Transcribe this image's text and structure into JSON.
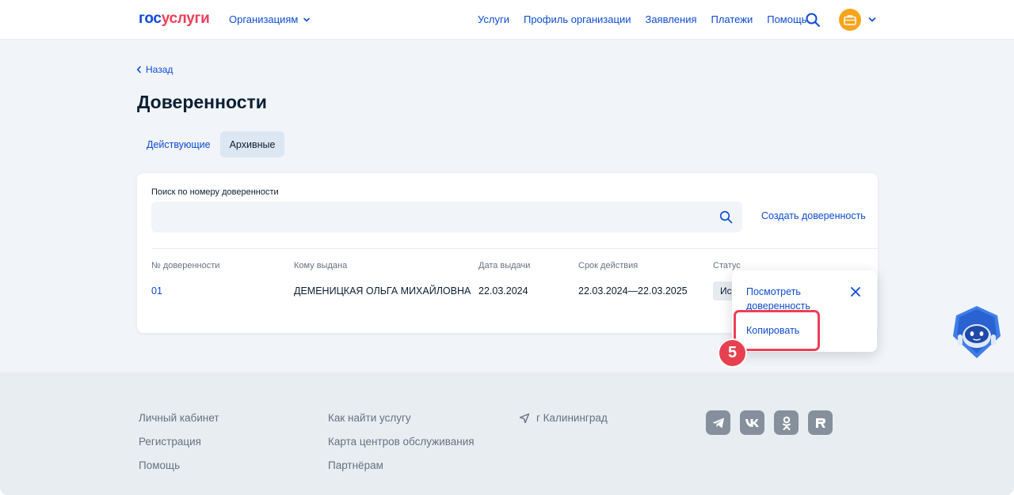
{
  "header": {
    "logo_part1": "гос",
    "logo_part2": "услуги",
    "org_menu": "Организациям",
    "nav": [
      "Услуги",
      "Профиль организации",
      "Заявления",
      "Платежи",
      "Помощь"
    ]
  },
  "main": {
    "back": "Назад",
    "title": "Доверенности",
    "tabs": [
      {
        "label": "Действующие",
        "active": false
      },
      {
        "label": "Архивные",
        "active": true
      }
    ],
    "search": {
      "label": "Поиск по номеру доверенности",
      "value": "",
      "placeholder": ""
    },
    "create_link": "Создать доверенность",
    "table": {
      "headers": [
        "№ доверенности",
        "Кому выдана",
        "Дата выдачи",
        "Срок действия",
        "Статус"
      ],
      "rows": [
        {
          "number": "01",
          "issued_to": "ДЕМЕНИЦКАЯ ОЛЬГА МИХАЙЛОВНА",
          "issue_date": "22.03.2024",
          "validity": "22.03.2024—22.03.2025",
          "status": "Ис"
        }
      ]
    }
  },
  "popup": {
    "view": "Посмотреть доверенность",
    "copy": "Копировать",
    "step": "5"
  },
  "footer": {
    "col1": [
      "Личный кабинет",
      "Регистрация",
      "Помощь"
    ],
    "col2": [
      "Как найти услугу",
      "Карта центров обслуживания",
      "Партнёрам"
    ],
    "city": "г Калининград",
    "socials": [
      "telegram-icon",
      "vk-icon",
      "odnoklassniki-icon",
      "rutube-icon"
    ]
  },
  "colors": {
    "accent": "#0d4cd3",
    "brand_red": "#ee3f58",
    "avatar": "#f7a41d",
    "background": "#f1f4f8"
  }
}
